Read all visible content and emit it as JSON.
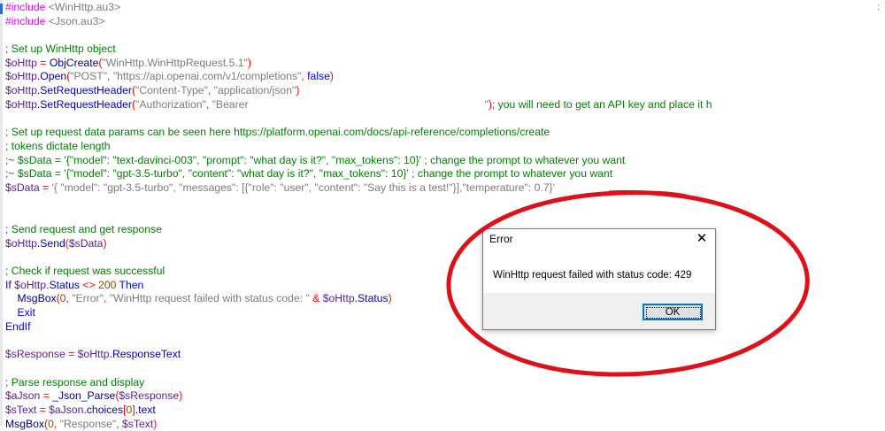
{
  "editor": {
    "lines": [
      [
        {
          "c": "dir",
          "t": "#include "
        },
        {
          "c": "str",
          "t": "<WinHttp.au3>"
        }
      ],
      [
        {
          "c": "dir",
          "t": "#include "
        },
        {
          "c": "str",
          "t": "<Json.au3>"
        }
      ],
      [],
      [
        {
          "c": "com",
          "t": "; Set up WinHttp object"
        }
      ],
      [
        {
          "c": "var",
          "t": "$oHttp"
        },
        {
          "c": "op",
          "t": " = "
        },
        {
          "c": "fn",
          "t": "ObjCreate"
        },
        {
          "c": "op",
          "t": "("
        },
        {
          "c": "str",
          "t": "\"WinHttp.WinHttpRequest.5.1\""
        },
        {
          "c": "op",
          "t": ")"
        }
      ],
      [
        {
          "c": "var",
          "t": "$oHttp"
        },
        {
          "c": "obj",
          "t": ".Open"
        },
        {
          "c": "op",
          "t": "("
        },
        {
          "c": "str",
          "t": "\"POST\""
        },
        {
          "c": "op",
          "t": ", "
        },
        {
          "c": "str",
          "t": "\"https://api.openai.com/v1/completions\""
        },
        {
          "c": "op",
          "t": ", "
        },
        {
          "c": "kw",
          "t": "false"
        },
        {
          "c": "op",
          "t": ")"
        }
      ],
      [
        {
          "c": "var",
          "t": "$oHttp"
        },
        {
          "c": "obj",
          "t": ".SetRequestHeader"
        },
        {
          "c": "op",
          "t": "("
        },
        {
          "c": "str",
          "t": "\"Content-Type\""
        },
        {
          "c": "op",
          "t": ", "
        },
        {
          "c": "str",
          "t": "\"application/json\""
        },
        {
          "c": "op",
          "t": ")"
        }
      ],
      [
        {
          "c": "var",
          "t": "$oHttp"
        },
        {
          "c": "obj",
          "t": ".SetRequestHeader"
        },
        {
          "c": "op",
          "t": "("
        },
        {
          "c": "str",
          "t": "\"Authorization\""
        },
        {
          "c": "op",
          "t": ", "
        },
        {
          "c": "str",
          "t": "\"Bearer "
        },
        {
          "c": "redact",
          "t": ""
        },
        {
          "c": "str",
          "t": "                              \""
        },
        {
          "c": "op",
          "t": "); "
        },
        {
          "c": "com",
          "t": "you will need to get an API key and place it h"
        }
      ],
      [],
      [
        {
          "c": "com",
          "t": "; Set up request data params can be seen here https://platform.openai.com/docs/api-reference/completions/create"
        }
      ],
      [
        {
          "c": "com",
          "t": "; tokens dictate length"
        }
      ],
      [
        {
          "c": "com",
          "t": ";~ $sData = '{\"model\": \"text-davinci-003\", \"prompt\": \"what day is it?\", \"max_tokens\": 10}' ; change the prompt to whatever you want"
        }
      ],
      [
        {
          "c": "com",
          "t": ";~ $sData = '{\"model\": \"gpt-3.5-turbo\", \"content\": \"what day is it?\", \"max_tokens\": 10}' ; change the prompt to whatever you want"
        }
      ],
      [
        {
          "c": "var",
          "t": "$sData"
        },
        {
          "c": "op",
          "t": " = "
        },
        {
          "c": "str",
          "t": "'{ \"model\": \"gpt-3.5-turbo\", \"messages\": [{\"role\": \"user\", \"content\": \"Say this is a test!\"}],\"temperature\": 0.7}'"
        }
      ],
      [],
      [],
      [
        {
          "c": "com",
          "t": "; Send request and get response"
        }
      ],
      [
        {
          "c": "var",
          "t": "$oHttp"
        },
        {
          "c": "obj",
          "t": ".Send"
        },
        {
          "c": "op",
          "t": "("
        },
        {
          "c": "var",
          "t": "$sData"
        },
        {
          "c": "op",
          "t": ")"
        }
      ],
      [],
      [
        {
          "c": "com",
          "t": "; Check if request was successful"
        }
      ],
      [
        {
          "c": "kw",
          "t": "If "
        },
        {
          "c": "var",
          "t": "$oHttp"
        },
        {
          "c": "obj",
          "t": ".Status"
        },
        {
          "c": "op",
          "t": " <> "
        },
        {
          "c": "num",
          "t": "200"
        },
        {
          "c": "kw",
          "t": " Then"
        }
      ],
      [
        {
          "c": "pl",
          "t": "    "
        },
        {
          "c": "fn",
          "t": "MsgBox"
        },
        {
          "c": "op",
          "t": "("
        },
        {
          "c": "num",
          "t": "0"
        },
        {
          "c": "op",
          "t": ", "
        },
        {
          "c": "str",
          "t": "\"Error\""
        },
        {
          "c": "op",
          "t": ", "
        },
        {
          "c": "str",
          "t": "\"WinHttp request failed with status code: \""
        },
        {
          "c": "op",
          "t": " & "
        },
        {
          "c": "var",
          "t": "$oHttp"
        },
        {
          "c": "obj",
          "t": ".Status"
        },
        {
          "c": "op",
          "t": ")"
        }
      ],
      [
        {
          "c": "pl",
          "t": "    "
        },
        {
          "c": "kw",
          "t": "Exit"
        }
      ],
      [
        {
          "c": "kw",
          "t": "EndIf"
        }
      ],
      [],
      [
        {
          "c": "var",
          "t": "$sResponse"
        },
        {
          "c": "op",
          "t": " = "
        },
        {
          "c": "var",
          "t": "$oHttp"
        },
        {
          "c": "obj",
          "t": ".ResponseText"
        }
      ],
      [],
      [
        {
          "c": "com",
          "t": "; Parse response and display"
        }
      ],
      [
        {
          "c": "var",
          "t": "$aJson"
        },
        {
          "c": "op",
          "t": " = "
        },
        {
          "c": "fn",
          "t": "_Json_Parse"
        },
        {
          "c": "op",
          "t": "("
        },
        {
          "c": "var",
          "t": "$sResponse"
        },
        {
          "c": "op",
          "t": ")"
        }
      ],
      [
        {
          "c": "var",
          "t": "$sText"
        },
        {
          "c": "op",
          "t": " = "
        },
        {
          "c": "var",
          "t": "$aJson"
        },
        {
          "c": "obj",
          "t": ".choices"
        },
        {
          "c": "op",
          "t": "["
        },
        {
          "c": "num",
          "t": "0"
        },
        {
          "c": "op",
          "t": "]"
        },
        {
          "c": "obj",
          "t": ".text"
        }
      ],
      [
        {
          "c": "fn",
          "t": "MsgBox"
        },
        {
          "c": "op",
          "t": "("
        },
        {
          "c": "num",
          "t": "0"
        },
        {
          "c": "op",
          "t": ", "
        },
        {
          "c": "str",
          "t": "\"Response\""
        },
        {
          "c": "op",
          "t": ", "
        },
        {
          "c": "var",
          "t": "$sText"
        },
        {
          "c": "op",
          "t": ")"
        }
      ]
    ],
    "scroll_indicator": ":"
  },
  "dialog": {
    "title": "Error",
    "close_glyph": "✕",
    "message": "WinHttp request failed with status code: 429",
    "ok_label": "OK"
  },
  "colors": {
    "annotation_circle": "#e0101a",
    "button_focus": "#0078d7"
  }
}
